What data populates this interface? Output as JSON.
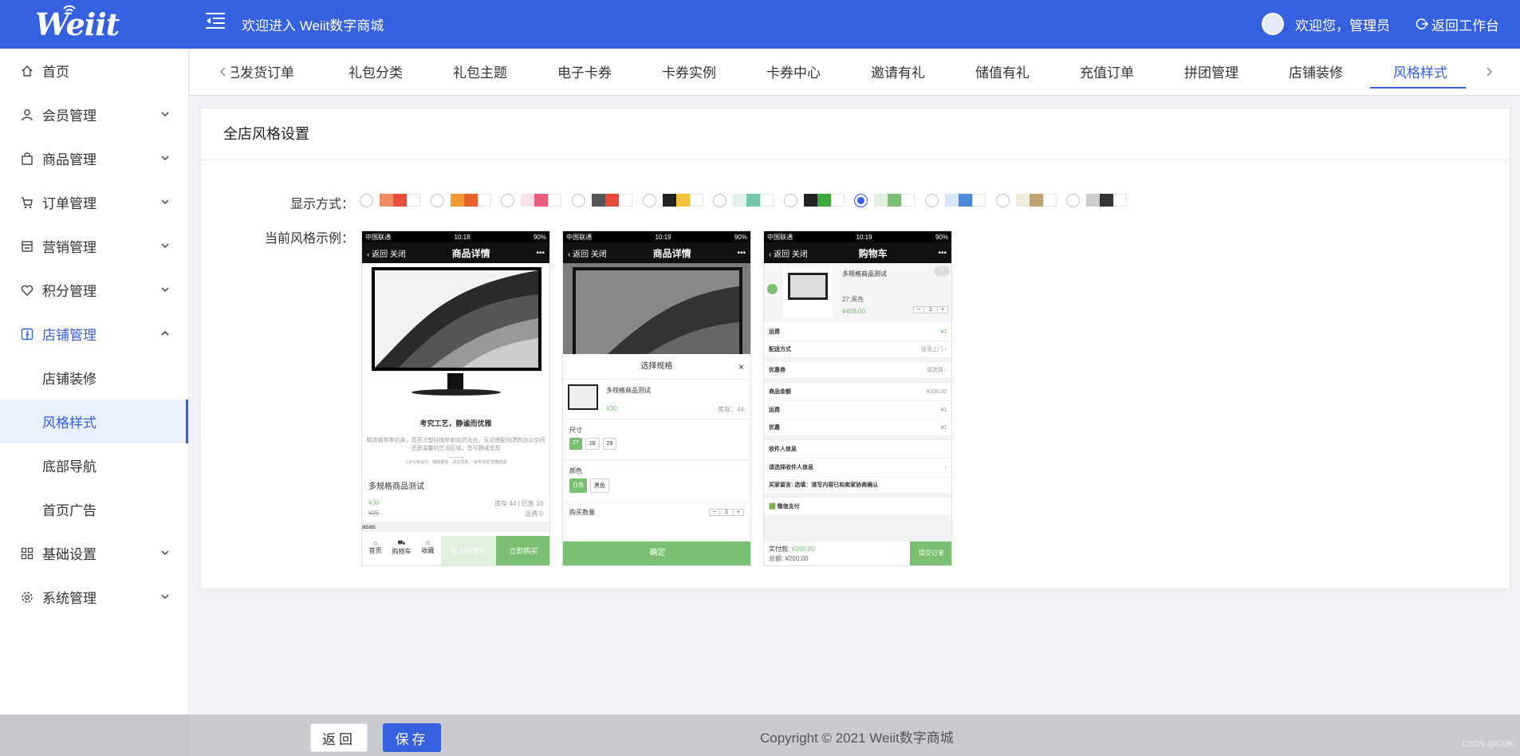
{
  "header": {
    "logo": "Weiit",
    "welcome": "欢迎进入 Weiit数字商城",
    "greeting": "欢迎您，管理员",
    "back_to_workbench": "返回工作台"
  },
  "sidebar": {
    "items": [
      {
        "label": "首页",
        "icon": "home-icon"
      },
      {
        "label": "会员管理",
        "icon": "user-icon"
      },
      {
        "label": "商品管理",
        "icon": "bag-icon"
      },
      {
        "label": "订单管理",
        "icon": "cart-icon"
      },
      {
        "label": "营销管理",
        "icon": "shop-icon"
      },
      {
        "label": "积分管理",
        "icon": "heart-icon"
      },
      {
        "label": "店铺管理",
        "icon": "facebook-icon"
      },
      {
        "label": "基础设置",
        "icon": "grid-icon"
      },
      {
        "label": "系统管理",
        "icon": "gear-icon"
      }
    ],
    "sub_items": [
      "店铺装修",
      "风格样式",
      "底部导航",
      "首页广告"
    ]
  },
  "tabs": [
    "已发货订单",
    "礼包分类",
    "礼包主题",
    "电子卡券",
    "卡券实例",
    "卡券中心",
    "邀请有礼",
    "储值有礼",
    "充值订单",
    "拼团管理",
    "店铺装修",
    "风格样式"
  ],
  "active_tab": "风格样式",
  "card": {
    "title": "全店风格设置",
    "display_label": "显示方式：",
    "example_label": "当前风格示例："
  },
  "swatches": [
    {
      "c1": "#f08c60",
      "c2": "#e84c3d",
      "checked": false
    },
    {
      "c1": "#f29a32",
      "c2": "#e8602c",
      "checked": false
    },
    {
      "c1": "#fde1e6",
      "c2": "#ec5d7b",
      "checked": false
    },
    {
      "c1": "#555555",
      "c2": "#e84c3d",
      "checked": false
    },
    {
      "c1": "#222222",
      "c2": "#f6c23e",
      "checked": false
    },
    {
      "c1": "#dff1ea",
      "c2": "#76c6a8",
      "checked": false
    },
    {
      "c1": "#222222",
      "c2": "#3aa83a",
      "checked": false
    },
    {
      "c1": "#dff0dc",
      "c2": "#7abf72",
      "checked": true
    },
    {
      "c1": "#d7e6fb",
      "c2": "#4e8ad9",
      "checked": false
    },
    {
      "c1": "#f1ebdc",
      "c2": "#c0a46d",
      "checked": false
    },
    {
      "c1": "#cccccc",
      "c2": "#333333",
      "checked": false
    }
  ],
  "phone_common": {
    "carrier": "中国联通",
    "battery": "90%",
    "back": "返回",
    "close": "关闭",
    "more": "•••"
  },
  "phone1": {
    "time": "10:18",
    "title": "商品详情",
    "slogan": "考究工艺，静谧而优雅",
    "desc1": "精选钢琴黑机身，亮亮注塑经抛析射自然光光，无论搭配何漂的办公空间",
    "desc2": "还是温馨的生活区域，皆可静谧呈现",
    "desc3": "三步分级设计，细腻钢琴，阔音漂亮，“采奔漂溺”亮丽成成",
    "product_name": "多规格商品测试",
    "price": "¥30",
    "old_price": "¥25",
    "stock": "库存 44 | 已售 10",
    "shipping": "运费 0",
    "tag": "asas",
    "nav_home": "首页",
    "nav_cart": "购物车",
    "nav_fav": "收藏",
    "add_cart": "加入购物车",
    "buy_now": "立即购买"
  },
  "phone2": {
    "time": "10:19",
    "title": "商品详情",
    "sheet_title": "选择规格",
    "close_x": "×",
    "product_name": "多规格商品测试",
    "price": "¥30",
    "stock": "库存：44",
    "size_label": "尺寸",
    "sizes": [
      "27",
      "28",
      "29"
    ],
    "color_label": "颜色",
    "colors": [
      "白色",
      "黑色"
    ],
    "qty_label": "购买数量",
    "qty": "1",
    "confirm": "确定"
  },
  "phone3": {
    "time": "10:19",
    "title": "购物车",
    "product_name": "多规格商品测试",
    "spec": "27;黑色",
    "price": "¥409.00",
    "qty": "1",
    "freight_label": "运费",
    "freight_value": "¥0",
    "delivery_label": "配送方式",
    "delivery_value": "送货上门",
    "coupon_label": "优惠券",
    "coupon_value": "请选择",
    "amount_label": "商品金额",
    "amount_value": "¥200.00",
    "freight2_label": "运费",
    "freight2_value": "¥0",
    "discount_label": "优惠",
    "discount_value": "¥0",
    "receiver_label": "收件人信息",
    "choose_receiver": "请选择收件人信息",
    "message_label": "买家留言:",
    "message_placeholder": "选填：请写内容已和卖家协商确认",
    "wechat_pay": "微信支付",
    "paid_label": "实付款:",
    "paid_value": "¥200.00",
    "total_label": "总额:",
    "total_value": "¥200.00",
    "submit": "提交订单"
  },
  "footer": {
    "back": "返回",
    "save": "保存",
    "copyright": "Copyright © 2021 Weiit数字商城",
    "watermark": "CSDN @KJJK"
  }
}
